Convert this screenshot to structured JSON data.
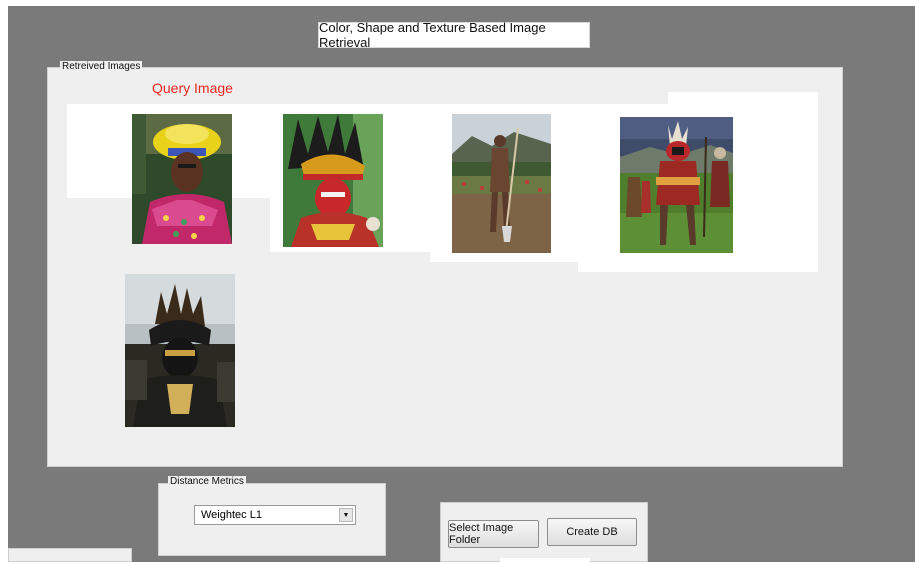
{
  "window": {
    "title": "Color, Shape and Texture Based Image Retrieval"
  },
  "retrieved_panel": {
    "legend": "Retreived Images",
    "query_label": "Query Image",
    "images": [
      {
        "name": "query-image",
        "subject": "woman with yellow headdress"
      },
      {
        "name": "result-image-1",
        "subject": "feathered headdress dancer"
      },
      {
        "name": "result-image-2",
        "subject": "man with spear in field"
      },
      {
        "name": "result-image-3",
        "subject": "costumed warrior"
      },
      {
        "name": "result-image-4",
        "subject": "black painted warrior"
      }
    ]
  },
  "distance_metrics": {
    "legend": "Distance Metrics",
    "selected": "Weightec L1"
  },
  "buttons": {
    "select_folder": "Select Image Folder",
    "create_db": "Create DB"
  },
  "colors": {
    "background": "#7a7a7a",
    "panel": "#efefef",
    "query_label": "#e8271e"
  }
}
